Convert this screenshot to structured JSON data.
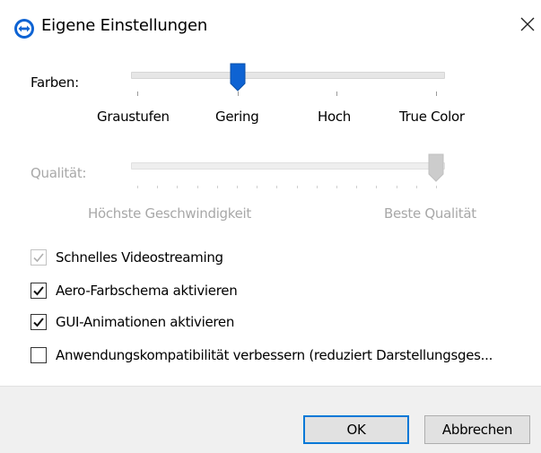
{
  "window": {
    "title": "Eigene Einstellungen",
    "app_icon": "teamviewer-icon",
    "close_icon": "close-icon",
    "accent_color": "#0e63d3"
  },
  "colors": {
    "label": "Farben:",
    "options": [
      "Graustufen",
      "Gering",
      "Hoch",
      "True Color"
    ],
    "selected": "Gering"
  },
  "quality": {
    "label": "Qualität:",
    "min_label": "Höchste Geschwindigkeit",
    "max_label": "Beste Qualität",
    "value_fraction": 1.0,
    "enabled": false
  },
  "options": [
    {
      "label": "Schnelles Videostreaming",
      "checked": true,
      "enabled": false
    },
    {
      "label": "Aero-Farbschema aktivieren",
      "checked": true,
      "enabled": true
    },
    {
      "label": "GUI-Animationen aktivieren",
      "checked": true,
      "enabled": true
    },
    {
      "label": "Anwendungskompatibilität verbessern (reduziert Darstellungsges...",
      "checked": false,
      "enabled": true
    }
  ],
  "buttons": {
    "ok": "OK",
    "cancel": "Abbrechen"
  }
}
